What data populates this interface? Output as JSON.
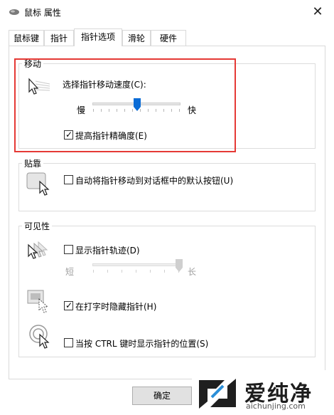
{
  "window": {
    "title": "鼠标 属性",
    "close_glyph": "✕",
    "icon": "mouse-icon"
  },
  "tabs": [
    {
      "label": "鼠标键"
    },
    {
      "label": "指针"
    },
    {
      "label": "指针选项",
      "active": true
    },
    {
      "label": "滑轮"
    },
    {
      "label": "硬件"
    }
  ],
  "motion": {
    "group_title": "移动",
    "speed_label": "选择指针移动速度(C):",
    "slow_label": "慢",
    "fast_label": "快",
    "speed_level": 0.5,
    "precision_label": "提高指针精确度(E)",
    "precision_checked": true,
    "icon": "pointer-motion-icon"
  },
  "snap": {
    "group_title": "贴靠",
    "snap_label": "自动将指针移动到对话框中的默认按钮(U)",
    "snap_checked": false,
    "icon": "snap-to-button-icon"
  },
  "visibility": {
    "group_title": "可见性",
    "trails_label": "显示指针轨迹(D)",
    "trails_checked": false,
    "short_label": "短",
    "long_label": "长",
    "trails_level": 1.0,
    "hide_label": "在打字时隐藏指针(H)",
    "hide_checked": true,
    "ctrl_label": "当按 CTRL 键时显示指针的位置(S)",
    "ctrl_checked": false,
    "icons": [
      "pointer-trails-icon",
      "hide-pointer-icon",
      "ctrl-locate-icon"
    ]
  },
  "buttons": {
    "ok_label": "确定"
  },
  "watermark": {
    "brand": "爱纯净",
    "url": "aichunjing.com"
  },
  "colors": {
    "highlight_border": "#e53935",
    "slider_thumb": "#0a6cd6"
  }
}
